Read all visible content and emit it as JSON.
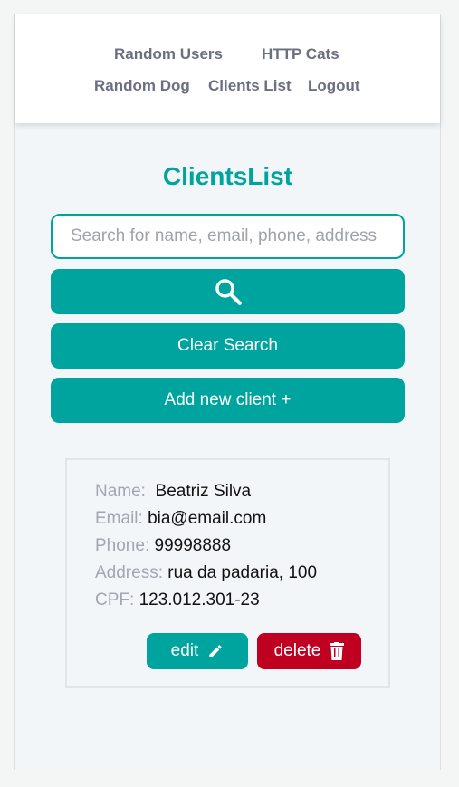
{
  "nav": {
    "items": [
      "Random Users",
      "HTTP Cats",
      "Random Dog",
      "Clients List",
      "Logout"
    ]
  },
  "page": {
    "title": "ClientsList"
  },
  "search": {
    "placeholder": "Search for name, email, phone, address",
    "value": ""
  },
  "buttons": {
    "search_icon": "search-icon",
    "clear": "Clear Search",
    "add": "Add new client +"
  },
  "clients": [
    {
      "name_label": "Name:",
      "name": "Beatriz Silva",
      "email_label": "Email:",
      "email": "bia@email.com",
      "phone_label": "Phone:",
      "phone": "99998888",
      "address_label": "Address:",
      "address": "rua da padaria, 100",
      "cpf_label": "CPF:",
      "cpf": "123.012.301-23",
      "edit": "edit",
      "delete": "delete"
    }
  ],
  "colors": {
    "accent": "#00a49f",
    "danger": "#bf0021"
  }
}
